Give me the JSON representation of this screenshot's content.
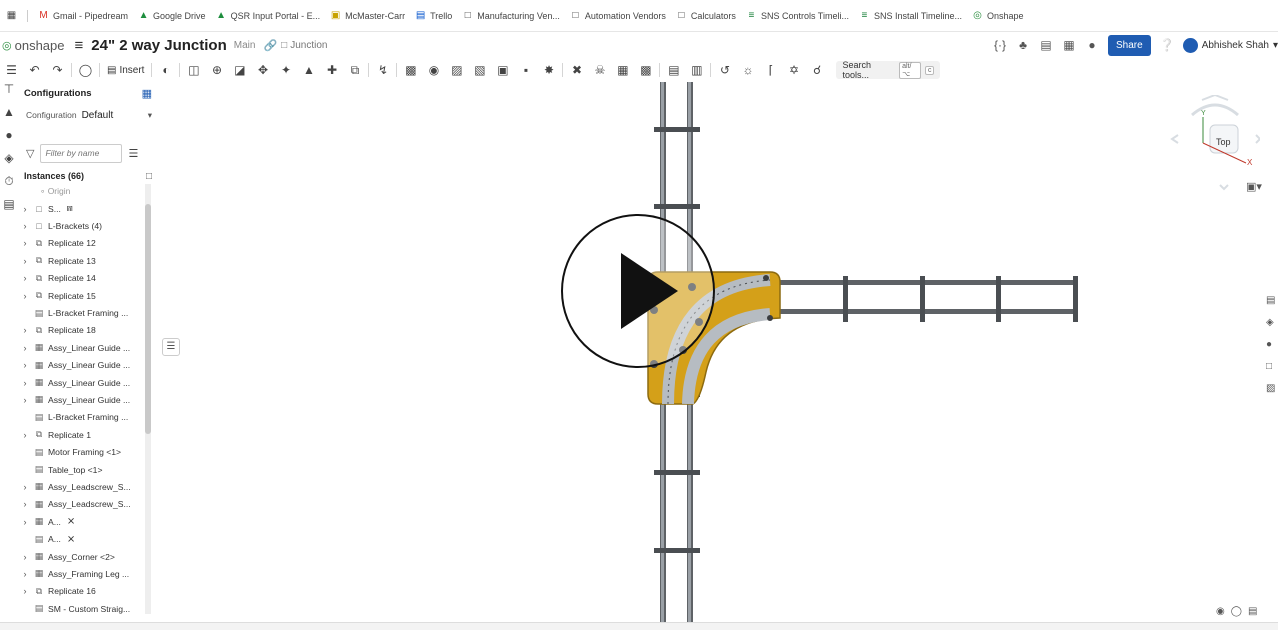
{
  "bookmarks": [
    {
      "icon": "apps-grid-icon",
      "label": ""
    },
    {
      "icon": "gmail-icon",
      "label": "Gmail - Pipedream"
    },
    {
      "icon": "google-drive-icon",
      "label": "Google Drive"
    },
    {
      "icon": "google-drive-icon",
      "label": "QSR Input Portal - E..."
    },
    {
      "icon": "mcmaster-icon",
      "label": "McMaster-Carr"
    },
    {
      "icon": "trello-icon",
      "label": "Trello"
    },
    {
      "icon": "folder-icon",
      "label": "Manufacturing Ven..."
    },
    {
      "icon": "folder-icon",
      "label": "Automation Vendors"
    },
    {
      "icon": "folder-icon",
      "label": "Calculators"
    },
    {
      "icon": "sheets-icon",
      "label": "SNS Controls Timeli..."
    },
    {
      "icon": "sheets-icon",
      "label": "SNS Install Timeline..."
    },
    {
      "icon": "onshape-icon",
      "label": "Onshape"
    }
  ],
  "header": {
    "logo_text": "onshape",
    "doc_title": "24\" 2 way Junction",
    "branch": "Main",
    "folder": "Junction",
    "share_label": "Share",
    "user_name": "Abhishek Shah"
  },
  "toolbar": {
    "insert_label": "Insert",
    "search_label": "Search tools...",
    "search_kbd1": "alt/⌥",
    "search_kbd2": "c"
  },
  "panel": {
    "config_title": "Configurations",
    "config_label": "Configuration",
    "config_value": "Default",
    "filter_placeholder": "Filter by name",
    "instances_title": "Instances (66)",
    "origin_label": "Origin",
    "items": [
      {
        "chev": "›",
        "icon": "folder-icon",
        "label": "S...",
        "extra": "⩎"
      },
      {
        "chev": "›",
        "icon": "folder-icon",
        "label": "L-Brackets (4)",
        "extra": ""
      },
      {
        "chev": "›",
        "icon": "replicate-icon",
        "label": "Replicate 12",
        "extra": ""
      },
      {
        "chev": "›",
        "icon": "replicate-icon",
        "label": "Replicate 13",
        "extra": ""
      },
      {
        "chev": "›",
        "icon": "replicate-icon",
        "label": "Replicate 14",
        "extra": ""
      },
      {
        "chev": "›",
        "icon": "replicate-icon",
        "label": "Replicate 15",
        "extra": ""
      },
      {
        "chev": "",
        "icon": "part-icon",
        "label": "L-Bracket Framing ...",
        "extra": ""
      },
      {
        "chev": "›",
        "icon": "replicate-icon",
        "label": "Replicate 18",
        "extra": ""
      },
      {
        "chev": "›",
        "icon": "assembly-icon",
        "label": "Assy_Linear Guide ...",
        "extra": ""
      },
      {
        "chev": "›",
        "icon": "assembly-icon",
        "label": "Assy_Linear Guide ...",
        "extra": ""
      },
      {
        "chev": "›",
        "icon": "assembly-icon",
        "label": "Assy_Linear Guide ...",
        "extra": ""
      },
      {
        "chev": "›",
        "icon": "assembly-icon",
        "label": "Assy_Linear Guide ...",
        "extra": ""
      },
      {
        "chev": "",
        "icon": "part-icon",
        "label": "L-Bracket Framing ...",
        "extra": ""
      },
      {
        "chev": "›",
        "icon": "replicate-icon",
        "label": "Replicate 1",
        "extra": ""
      },
      {
        "chev": "",
        "icon": "part-icon",
        "label": "Motor Framing <1>",
        "extra": ""
      },
      {
        "chev": "",
        "icon": "part-icon",
        "label": "Table_top <1>",
        "extra": ""
      },
      {
        "chev": "›",
        "icon": "assembly-icon",
        "label": "Assy_Leadscrew_S...",
        "extra": ""
      },
      {
        "chev": "›",
        "icon": "assembly-icon",
        "label": "Assy_Leadscrew_S...",
        "extra": ""
      },
      {
        "chev": "›",
        "icon": "assembly-icon",
        "label": "A...",
        "extra": "⨯"
      },
      {
        "chev": "",
        "icon": "part-icon",
        "label": "A...",
        "extra": "⨯"
      },
      {
        "chev": "›",
        "icon": "assembly-icon",
        "label": "Assy_Corner <2>",
        "extra": ""
      },
      {
        "chev": "›",
        "icon": "assembly-icon",
        "label": "Assy_Framing Leg ...",
        "extra": ""
      },
      {
        "chev": "›",
        "icon": "replicate-icon",
        "label": "Replicate 16",
        "extra": ""
      },
      {
        "chev": "",
        "icon": "part-icon",
        "label": "SM - Custom Straig...",
        "extra": ""
      }
    ]
  },
  "viewcube": {
    "face_label": "Top",
    "x_axis": "X",
    "y_axis": "Y"
  },
  "colors": {
    "plate": "#d4a019",
    "rail": "#9aa0a6",
    "share": "#1f5cb2"
  }
}
